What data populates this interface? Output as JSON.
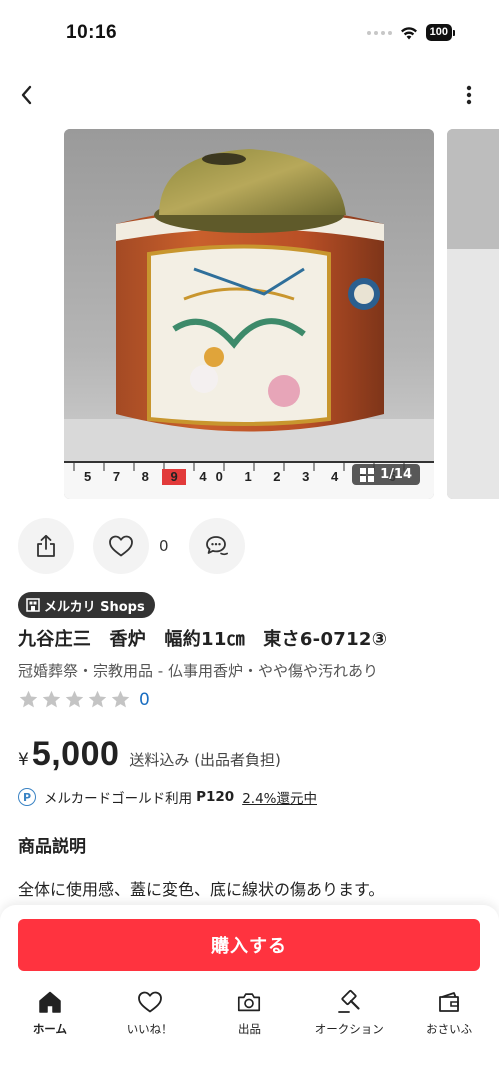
{
  "status_bar": {
    "time": "10:16",
    "battery": "100"
  },
  "nav": {
    "back_icon": "chevron-left-icon",
    "more_icon": "more-vertical-icon"
  },
  "gallery": {
    "counter": "1/14",
    "counter_icon": "grid-icon",
    "ruler_numbers": "5 7 8 9 40 1 2 3 4 5 6"
  },
  "actions": {
    "share_icon": "share-icon",
    "like_icon": "heart-icon",
    "like_count": "0",
    "comment_icon": "comment-icon"
  },
  "item": {
    "shop_badge": "メルカリ Shops",
    "title": "九谷庄三　香炉　幅約11㎝　東さ6-0712③",
    "category": "冠婚葬祭・宗教用品 - 仏事用香炉・やや傷や汚れあり",
    "rating_stars": 0,
    "rating_count": "0",
    "price_currency": "¥",
    "price": "5,000",
    "price_note": "送料込み (出品者負担)",
    "points_text": "メルカードゴールド利用",
    "points_amount": "P120",
    "points_rate": "2.4%還元中"
  },
  "description": {
    "heading": "商品説明",
    "text": "全体に使用感、蓋に変色、底に線状の傷あります。"
  },
  "purchase": {
    "button_label": "購入する"
  },
  "tabs": [
    {
      "label": "ホーム",
      "icon": "home-icon",
      "active": true
    },
    {
      "label": "いいね！",
      "icon": "heart-icon",
      "active": false
    },
    {
      "label": "出品",
      "icon": "camera-icon",
      "active": false
    },
    {
      "label": "オークション",
      "icon": "gavel-icon",
      "active": false
    },
    {
      "label": "おさいふ",
      "icon": "wallet-icon",
      "active": false
    }
  ],
  "colors": {
    "buy_button": "#ff333f",
    "link_blue": "#1a6ec1",
    "badge_dark": "#333333"
  }
}
